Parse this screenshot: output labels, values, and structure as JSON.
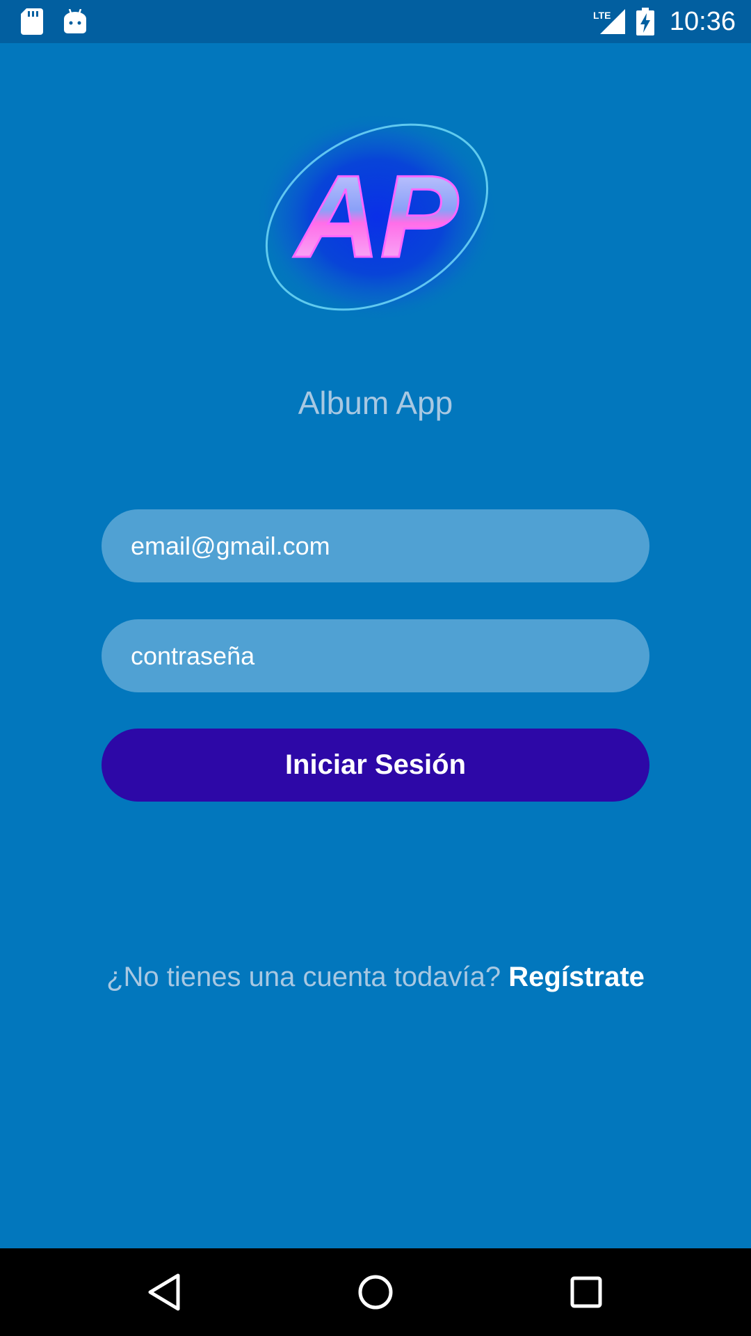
{
  "status_bar": {
    "time": "10:36",
    "network": "LTE",
    "icons": [
      "sd-card-icon",
      "android-icon",
      "lte-signal-icon",
      "battery-charging-icon"
    ]
  },
  "logo": {
    "text": "AP"
  },
  "app": {
    "title": "Album App"
  },
  "form": {
    "email_placeholder": "email@gmail.com",
    "password_placeholder": "contraseña",
    "login_label": "Iniciar Sesión"
  },
  "register": {
    "prompt": "¿No tienes una cuenta todavía?",
    "link": "Regístrate"
  },
  "nav": {
    "icons": [
      "back-icon",
      "home-icon",
      "recents-icon"
    ]
  },
  "colors": {
    "background": "#0277bd",
    "status_bar": "#025fa0",
    "input_fill": "#50a1d3",
    "button": "#2d08a7",
    "muted_text": "#a8c8e2"
  }
}
